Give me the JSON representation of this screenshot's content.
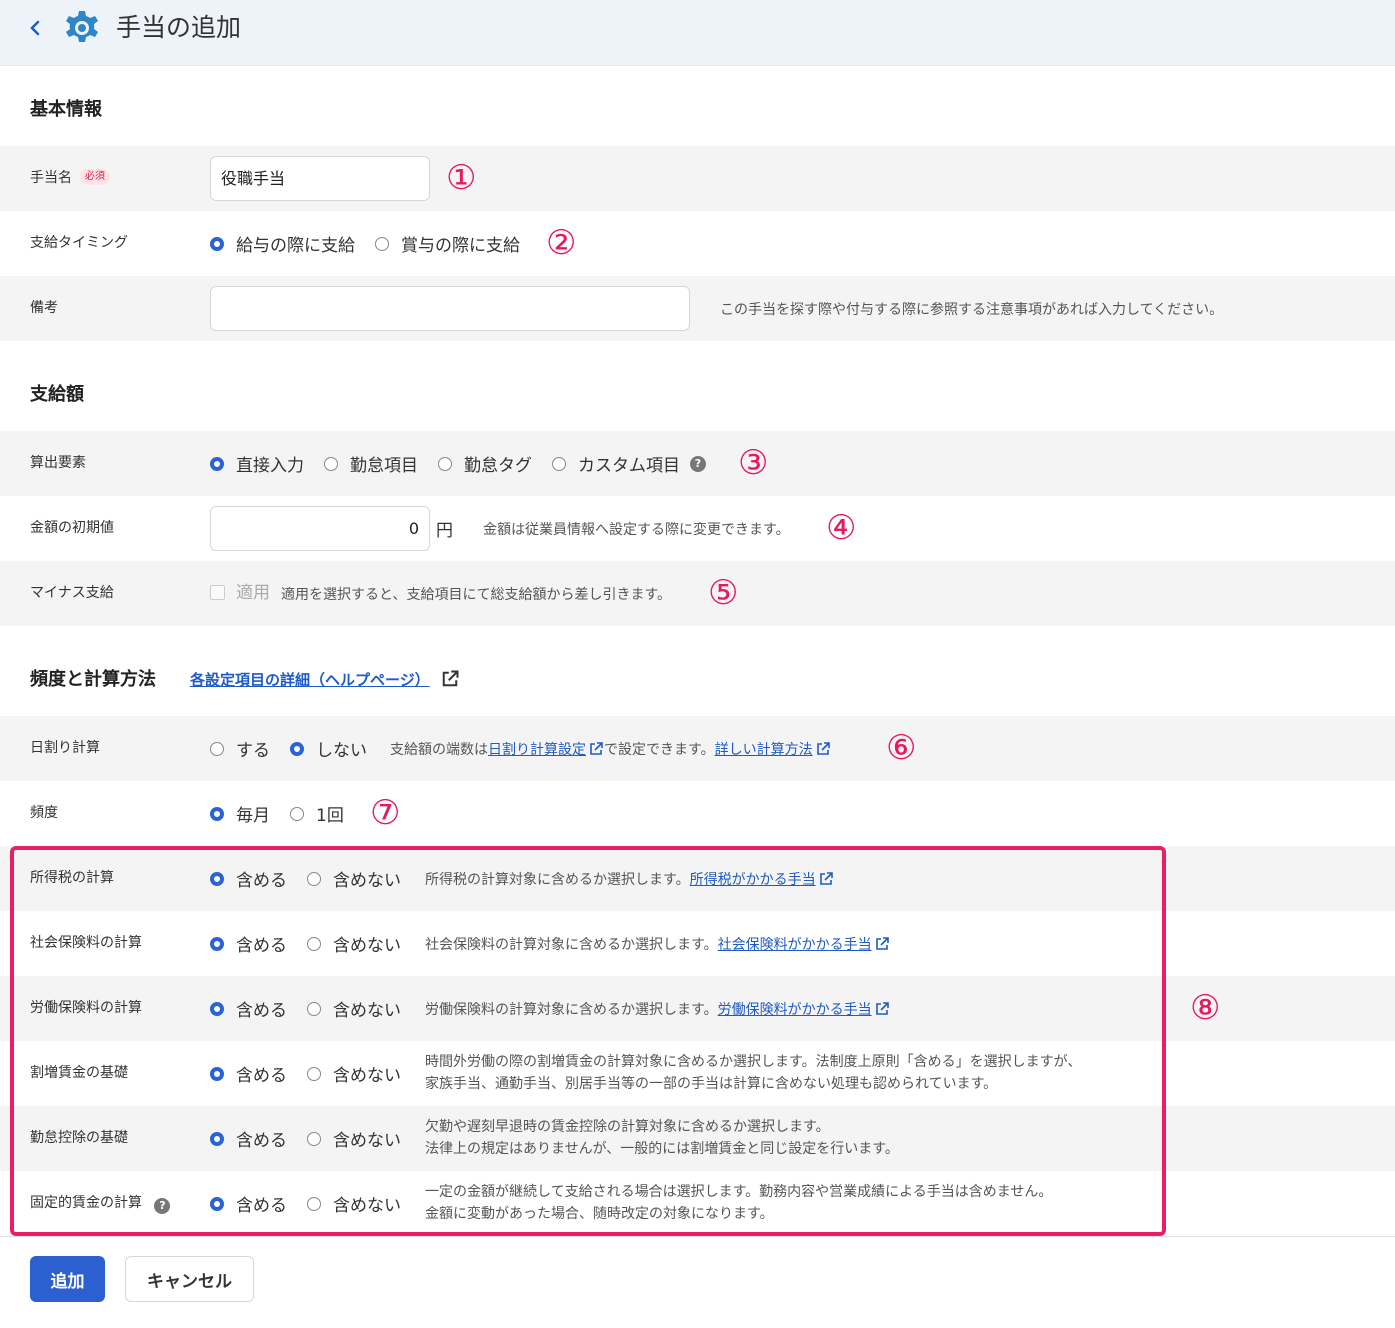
{
  "header": {
    "title": "手当の追加"
  },
  "sections": {
    "basic": "基本情報",
    "amount": "支給額",
    "frequency": "頻度と計算方法",
    "help_link": "各設定項目の詳細（ヘルプページ）"
  },
  "fields": {
    "name": {
      "label": "手当名",
      "required": "必須",
      "value": "役職手当"
    },
    "timing": {
      "label": "支給タイミング",
      "opt1": "給与の際に支給",
      "opt2": "賞与の際に支給"
    },
    "note": {
      "label": "備考",
      "value": "",
      "hint": "この手当を探す際や付与する際に参照する注意事項があれば入力してください。"
    },
    "calc_element": {
      "label": "算出要素",
      "opt1": "直接入力",
      "opt2": "勤怠項目",
      "opt3": "勤怠タグ",
      "opt4": "カスタム項目"
    },
    "initial_amount": {
      "label": "金額の初期値",
      "value": "0",
      "unit": "円",
      "hint": "金額は従業員情報へ設定する際に変更できます。"
    },
    "minus": {
      "label": "マイナス支給",
      "checkbox": "適用",
      "hint": "適用を選択すると、支給項目にて総支給額から差し引きます。"
    },
    "daily": {
      "label": "日割り計算",
      "opt1": "する",
      "opt2": "しない",
      "hint_a": "支給額の端数は",
      "link1": "日割り計算設定",
      "hint_b": "で設定できます。",
      "link2": "詳しい計算方法"
    },
    "freq": {
      "label": "頻度",
      "opt1": "毎月",
      "opt2": "1回"
    }
  },
  "calc_rows": [
    {
      "label": "所得税の計算",
      "include": "含める",
      "exclude": "含めない",
      "hint": "所得税の計算対象に含めるか選択します。",
      "link": "所得税がかかる手当"
    },
    {
      "label": "社会保険料の計算",
      "include": "含める",
      "exclude": "含めない",
      "hint": "社会保険料の計算対象に含めるか選択します。",
      "link": "社会保険料がかかる手当"
    },
    {
      "label": "労働保険料の計算",
      "include": "含める",
      "exclude": "含めない",
      "hint": "労働保険料の計算対象に含めるか選択します。",
      "link": "労働保険料がかかる手当"
    },
    {
      "label": "割増賃金の基礎",
      "include": "含める",
      "exclude": "含めない",
      "hint1": "時間外労働の際の割増賃金の計算対象に含めるか選択します。法制度上原則「含める」を選択しますが、",
      "hint2": "家族手当、通勤手当、別居手当等の一部の手当は計算に含めない処理も認められています。"
    },
    {
      "label": "勤怠控除の基礎",
      "include": "含める",
      "exclude": "含めない",
      "hint1": "欠勤や遅刻早退時の賃金控除の計算対象に含めるか選択します。",
      "hint2": "法律上の規定はありませんが、一般的には割増賃金と同じ設定を行います。"
    },
    {
      "label": "固定的賃金の計算",
      "include": "含める",
      "exclude": "含めない",
      "hint1": "一定の金額が継続して支給される場合は選択します。勤務内容や営業成績による手当は含めません。",
      "hint2": "金額に変動があった場合、随時改定の対象になります。"
    }
  ],
  "markers": [
    "①",
    "②",
    "③",
    "④",
    "⑤",
    "⑥",
    "⑦",
    "⑧"
  ],
  "buttons": {
    "add": "追加",
    "cancel": "キャンセル"
  },
  "colors": {
    "accent": "#2c5fcf",
    "marker": "#e51a5e",
    "highlight": "#e91e63"
  }
}
